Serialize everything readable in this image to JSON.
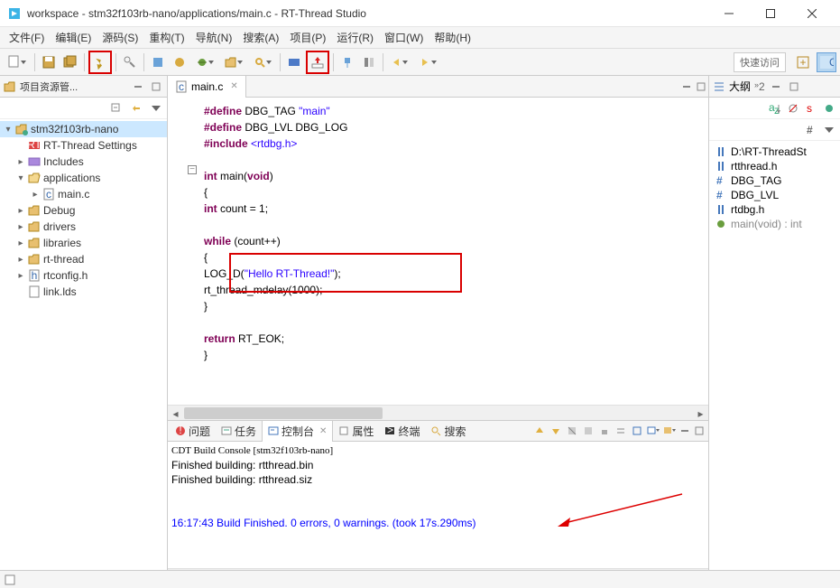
{
  "window": {
    "title": "workspace - stm32f103rb-nano/applications/main.c - RT-Thread Studio"
  },
  "menu": {
    "file": "文件(F)",
    "edit": "编辑(E)",
    "source": "源码(S)",
    "refactor": "重构(T)",
    "navigate": "导航(N)",
    "search": "搜索(A)",
    "project": "项目(P)",
    "run": "运行(R)",
    "window": "窗口(W)",
    "help": "帮助(H)"
  },
  "toolbar": {
    "quick_access": "快速访问"
  },
  "project_explorer": {
    "title": "项目资源管...",
    "tree": [
      {
        "label": "stm32f103rb-nano",
        "icon": "folder-project",
        "expand": "open",
        "depth": 0,
        "sel": true
      },
      {
        "label": "RT-Thread Settings",
        "icon": "rt",
        "depth": 1
      },
      {
        "label": "Includes",
        "icon": "includes",
        "expand": "closed",
        "depth": 1
      },
      {
        "label": "applications",
        "icon": "folder-open",
        "expand": "open",
        "depth": 1
      },
      {
        "label": "main.c",
        "icon": "c-file",
        "expand": "closed",
        "depth": 2
      },
      {
        "label": "Debug",
        "icon": "folder",
        "expand": "closed",
        "depth": 1
      },
      {
        "label": "drivers",
        "icon": "folder",
        "expand": "closed",
        "depth": 1
      },
      {
        "label": "libraries",
        "icon": "folder",
        "expand": "closed",
        "depth": 1
      },
      {
        "label": "rt-thread",
        "icon": "folder",
        "expand": "closed",
        "depth": 1
      },
      {
        "label": "rtconfig.h",
        "icon": "h-file",
        "expand": "closed",
        "depth": 1
      },
      {
        "label": "link.lds",
        "icon": "file",
        "depth": 1
      }
    ]
  },
  "editor": {
    "tab_label": "main.c",
    "code": {
      "l1a": "#define",
      "l1b": " DBG_TAG ",
      "l1c": "\"main\"",
      "l2a": "#define",
      "l2b": " DBG_LVL DBG_LOG",
      "l3a": "#include ",
      "l3b": "<rtdbg.h>",
      "l5a": "int",
      "l5b": " main(",
      "l5c": "void",
      "l5d": ")",
      "l6": "{",
      "l7a": "    ",
      "l7b": "int",
      "l7c": " count = 1;",
      "l9a": "    ",
      "l9b": "while",
      "l9c": " (count++)",
      "l10": "    {",
      "l11a": "        LOG_D(",
      "l11b": "\"Hello RT-Thread!\"",
      "l11c": ");",
      "l12": "        rt_thread_mdelay(1000);",
      "l13": "    }",
      "l15a": "    ",
      "l15b": "return",
      "l15c": " RT_EOK;",
      "l16": "}"
    }
  },
  "bottom": {
    "problems": "问题",
    "tasks": "任务",
    "console": "控制台",
    "properties": "属性",
    "terminal": "终端",
    "search": "搜索"
  },
  "console": {
    "header": "CDT Build Console [stm32f103rb-nano]",
    "line1": "Finished building: rtthread.bin",
    "line2": "Finished building: rtthread.siz",
    "result": "16:17:43 Build Finished. 0 errors, 0 warnings. (took 17s.290ms)"
  },
  "outline_view": {
    "title": "大纲",
    "items": [
      {
        "icon": "inc",
        "label": "D:\\RT-ThreadSt"
      },
      {
        "icon": "inc",
        "label": "rtthread.h"
      },
      {
        "icon": "def",
        "label": "DBG_TAG"
      },
      {
        "icon": "def",
        "label": "DBG_LVL"
      },
      {
        "icon": "inc",
        "label": "rtdbg.h"
      },
      {
        "icon": "fn",
        "label": "main(void) : int"
      }
    ]
  }
}
